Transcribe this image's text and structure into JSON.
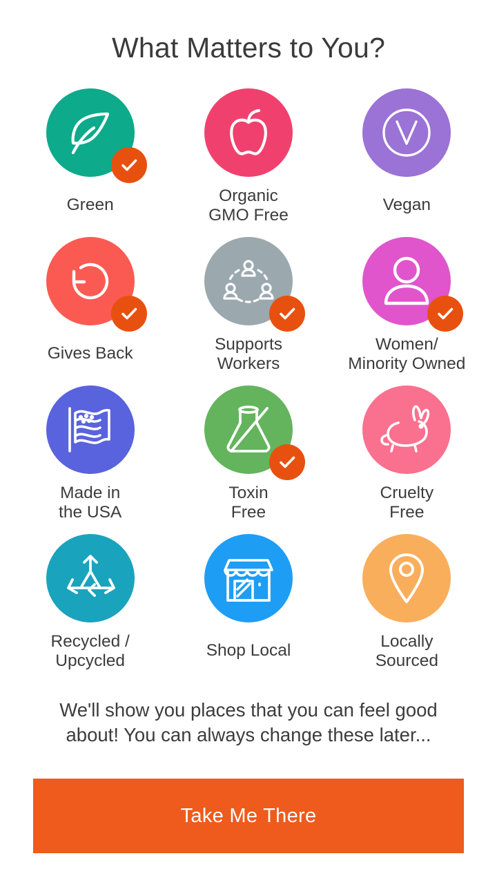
{
  "header": {
    "title": "What Matters to You?"
  },
  "colors": {
    "badge": "#e8500f",
    "cta_background": "#ee5b1c",
    "cta_text": "#ffffff",
    "label_text": "#3c3c3c"
  },
  "grid": {
    "items": [
      {
        "label": "Green",
        "icon": "leaf-icon",
        "color": "#0daa8b",
        "selected": true
      },
      {
        "label": "Organic\nGMO Free",
        "icon": "apple-icon",
        "color": "#f0416e",
        "selected": false
      },
      {
        "label": "Vegan",
        "icon": "vegan-v-icon",
        "color": "#9b72d6",
        "selected": false
      },
      {
        "label": "Gives Back",
        "icon": "circular-arrow-icon",
        "color": "#fb5a52",
        "selected": true
      },
      {
        "label": "Supports\nWorkers",
        "icon": "people-network-icon",
        "color": "#9ba8ae",
        "selected": true
      },
      {
        "label": "Women/\nMinority Owned",
        "icon": "person-icon",
        "color": "#e055cb",
        "selected": true
      },
      {
        "label": "Made in\nthe USA",
        "icon": "usa-flag-icon",
        "color": "#5963dd",
        "selected": false
      },
      {
        "label": "Toxin\nFree",
        "icon": "no-flask-icon",
        "color": "#64b45d",
        "selected": true
      },
      {
        "label": "Cruelty\nFree",
        "icon": "rabbit-icon",
        "color": "#fa708f",
        "selected": false
      },
      {
        "label": "Recycled /\nUpcycled",
        "icon": "recycle-icon",
        "color": "#1aa3bc",
        "selected": false
      },
      {
        "label": "Shop Local",
        "icon": "storefront-icon",
        "color": "#1e9df5",
        "selected": false
      },
      {
        "label": "Locally\nSourced",
        "icon": "map-pin-icon",
        "color": "#f9ae5c",
        "selected": false
      }
    ]
  },
  "footer": {
    "note": "We'll show you places that you can feel good about! You can always change these later...",
    "cta_label": "Take Me There"
  }
}
